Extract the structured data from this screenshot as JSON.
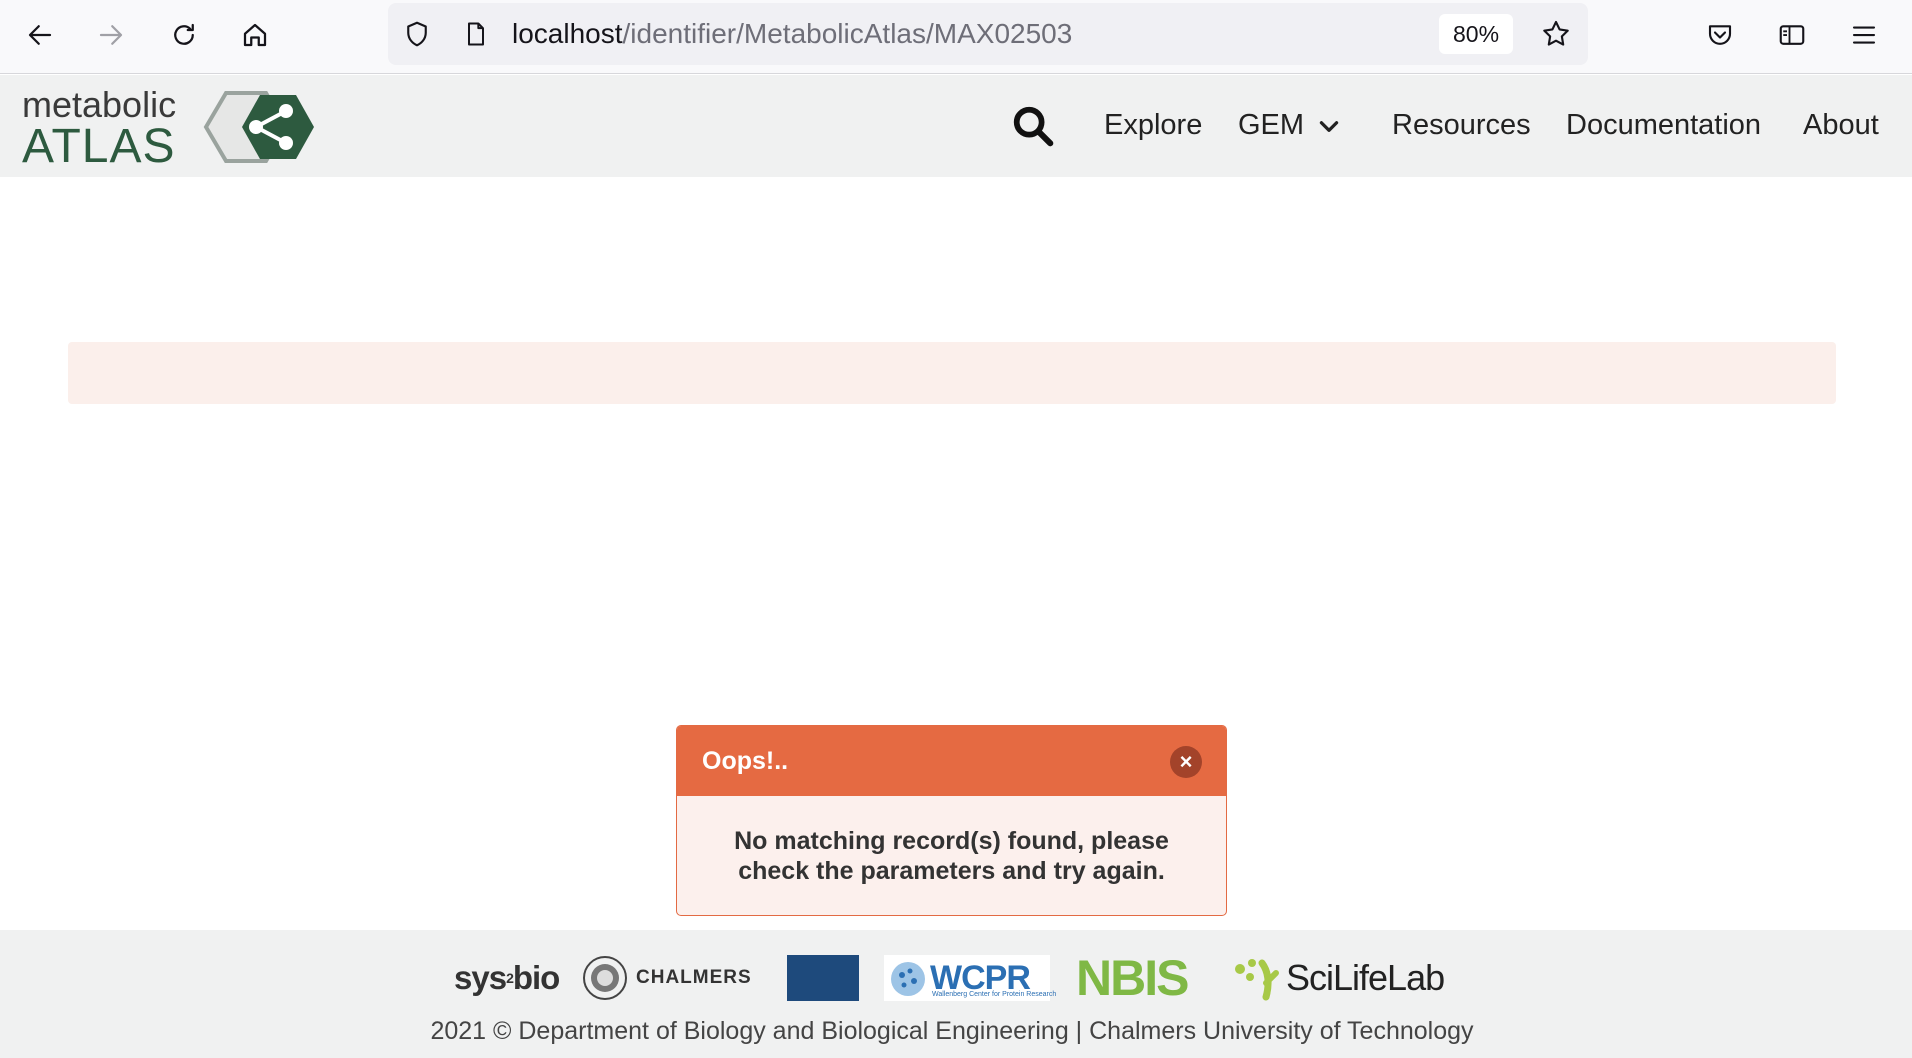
{
  "browser": {
    "url_host": "localhost",
    "url_path": "/identifier/MetabolicAtlas/MAX02503",
    "zoom": "80%",
    "icons": [
      "back-arrow-icon",
      "forward-arrow-icon",
      "reload-icon",
      "home-icon",
      "shield-icon",
      "page-icon",
      "bookmark-star-icon",
      "pocket-icon",
      "sidebar-icon",
      "menu-icon"
    ]
  },
  "header": {
    "logo_top": "metabolic",
    "logo_bottom": "ATLAS",
    "nav": {
      "explore": "Explore",
      "gem": "GEM",
      "resources": "Resources",
      "documentation": "Documentation",
      "about": "About"
    }
  },
  "error": {
    "title": "Oops!..",
    "close": "×",
    "message": "No matching record(s) found, please check the parameters and try again."
  },
  "footer": {
    "partners": {
      "sysbio": "sys",
      "sysbio_sup": "2",
      "sysbio_end": "bio",
      "chalmers": "CHALMERS",
      "wcpr": "WCPR",
      "wcpr_sub": "Wallenberg Center for Protein Research",
      "nbis": "NBIS",
      "scilifelab": "SciLifeLab"
    },
    "copyright": "2021 ©  Department of Biology and Biological Engineering |  Chalmers University of Technology"
  },
  "colors": {
    "header_bg": "#f0f1f1",
    "error_header": "#e56a42",
    "error_body": "#fcf0ed",
    "alert_strip": "#fbefeb",
    "logo_green": "#2d5a3f"
  }
}
